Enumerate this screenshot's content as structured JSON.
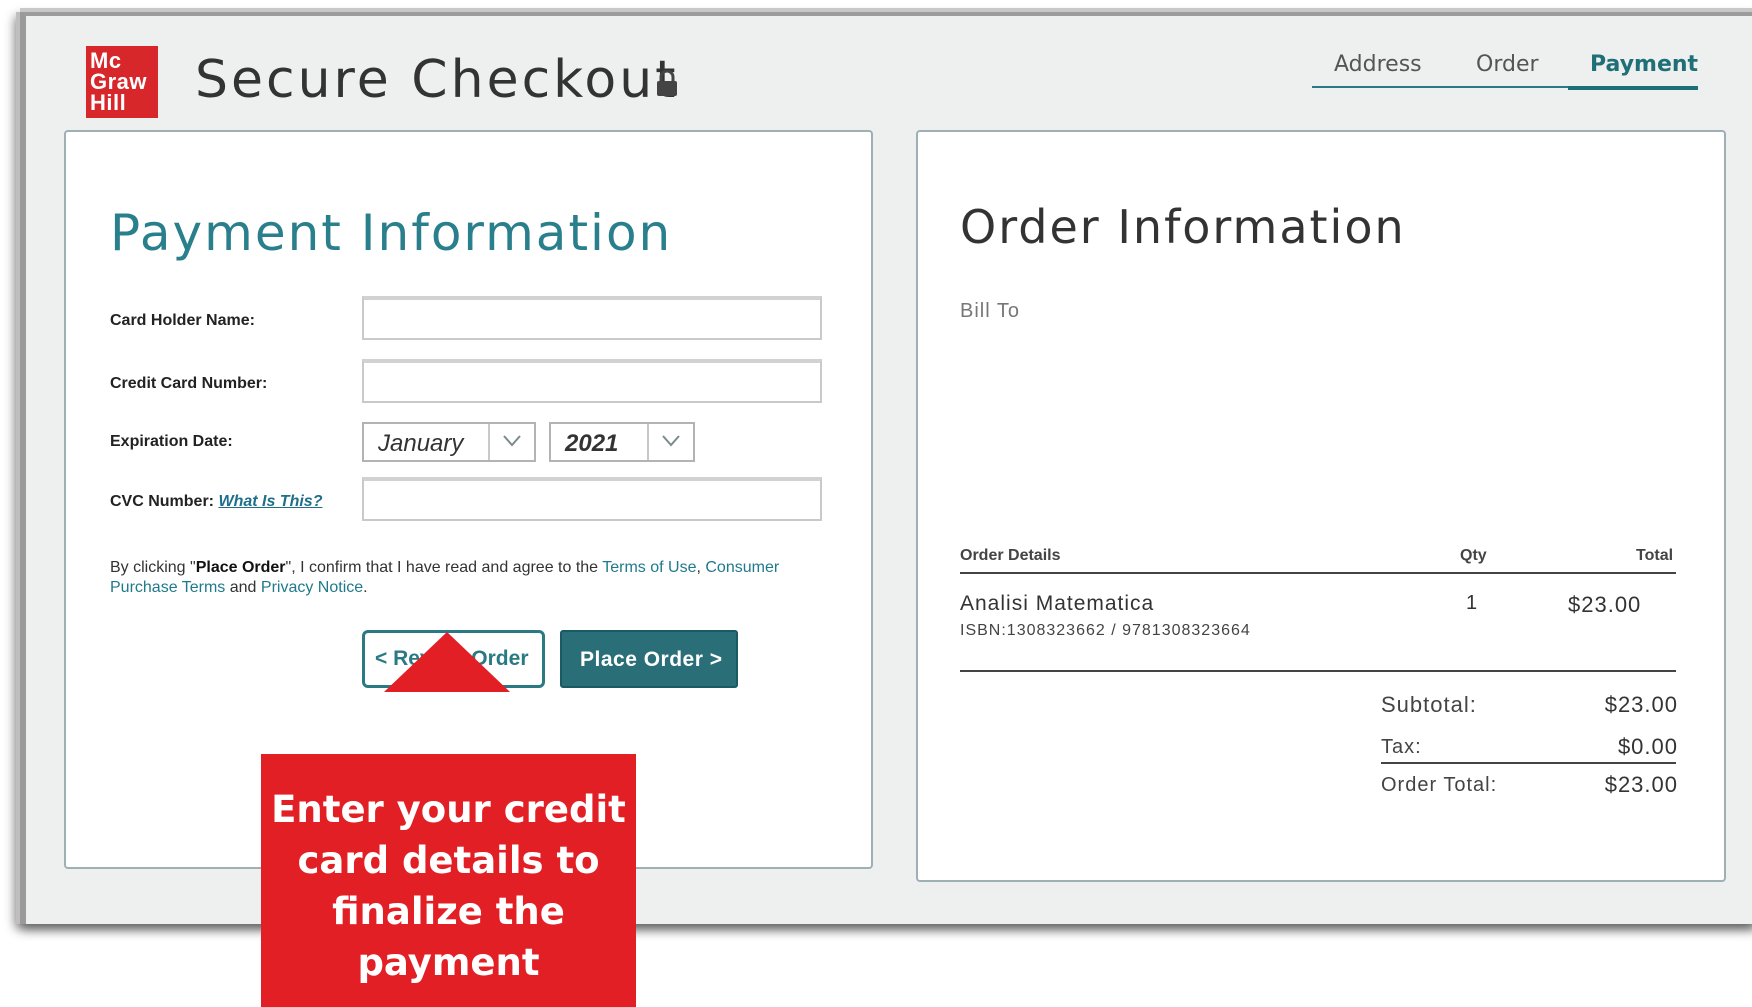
{
  "header": {
    "logo_lines": [
      "Mc",
      "Graw",
      "Hill"
    ],
    "title": "Secure Checkout",
    "steps": [
      {
        "label": "Address",
        "active": false
      },
      {
        "label": "Order",
        "active": false
      },
      {
        "label": "Payment",
        "active": true
      }
    ]
  },
  "payment": {
    "heading": "Payment Information",
    "card_holder_label": "Card Holder Name:",
    "card_holder_value": "",
    "card_number_label": "Credit Card Number:",
    "card_number_value": "",
    "expiration_label": "Expiration Date:",
    "exp_month": "January",
    "exp_year": "2021",
    "cvc_label": "CVC Number:",
    "cvc_help_link": "What Is This?",
    "cvc_value": "",
    "legal": {
      "prefix": "By clicking \"",
      "bold": "Place Order",
      "middle": "\", I confirm that I have read and agree to the ",
      "terms": "Terms of Use",
      "comma": ", ",
      "consumer": "Consumer Purchase Terms",
      "and": " and ",
      "privacy": "Privacy Notice",
      "end": "."
    },
    "review_button": "< Review Order",
    "place_button": "Place Order >"
  },
  "order": {
    "heading": "Order Information",
    "bill_to": "Bill To",
    "columns": {
      "details": "Order Details",
      "qty": "Qty",
      "total": "Total"
    },
    "items": [
      {
        "name": "Analisi Matematica",
        "isbn": "ISBN:1308323662 / 9781308323664",
        "qty": "1",
        "total": "$23.00"
      }
    ],
    "subtotal_label": "Subtotal:",
    "subtotal": "$23.00",
    "tax_label": "Tax:",
    "tax": "$0.00",
    "order_total_label": "Order Total:",
    "order_total": "$23.00"
  },
  "callout": {
    "text_lines": [
      "Enter your credit",
      "card details to",
      "finalize the",
      "payment"
    ]
  },
  "colors": {
    "brand_red": "#d7272a",
    "teal": "#2a7a83",
    "callout_red": "#e31f26"
  }
}
